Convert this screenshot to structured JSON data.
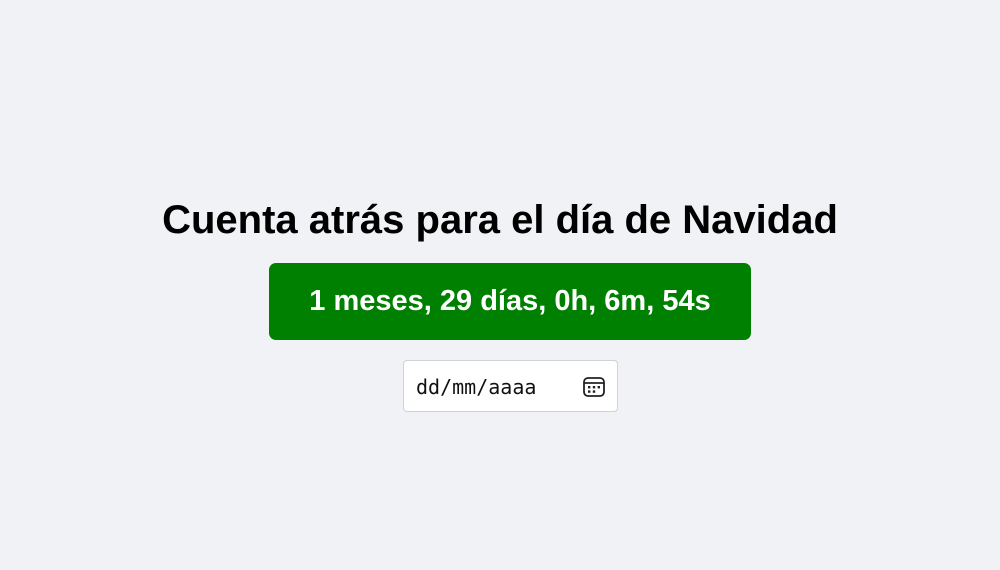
{
  "page": {
    "title": "Cuenta atrás para el día de Navidad"
  },
  "countdown": {
    "text": "1 meses, 29 días, 0h, 6m, 54s",
    "background_color": "#008000",
    "text_color": "#ffffff"
  },
  "date_input": {
    "placeholder": "dd/mm/aaaa",
    "value": "",
    "icon": "calendar-icon"
  },
  "colors": {
    "background": "#f0f2f5"
  }
}
